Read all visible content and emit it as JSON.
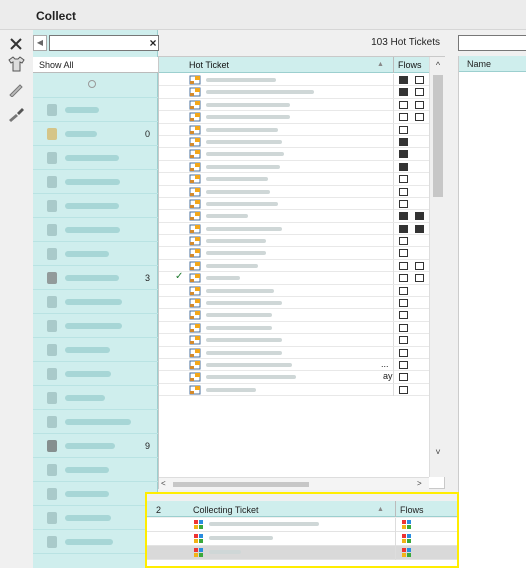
{
  "window": {
    "title": "Collect"
  },
  "toolbar": {
    "icons": [
      "close-icon",
      "shirt-icon",
      "marker-icon",
      "brush-icon"
    ]
  },
  "search": {
    "placeholder": "",
    "count_label": "103 Hot Tickets",
    "right_placeholder": ""
  },
  "left": {
    "show_all": "Show All",
    "counts": [
      "0",
      "3",
      "9",
      "2"
    ]
  },
  "table": {
    "headers": {
      "ticket": "Hot Ticket",
      "flows": "Flows"
    },
    "rows": [
      {
        "flows": [
          "ticket",
          "doc"
        ]
      },
      {
        "flows": [
          "ticket",
          "doc"
        ]
      },
      {
        "flows": [
          "box",
          "doc"
        ]
      },
      {
        "flows": [
          "box",
          "doc"
        ]
      },
      {
        "flows": [
          "doc"
        ]
      },
      {
        "flows": [
          "ticket"
        ]
      },
      {
        "flows": [
          "ticket"
        ]
      },
      {
        "flows": [
          "ticket"
        ]
      },
      {
        "flows": [
          "disk"
        ]
      },
      {
        "flows": [
          "disk"
        ]
      },
      {
        "flows": [
          "doc"
        ]
      },
      {
        "flows": [
          "ticket",
          "ticket"
        ]
      },
      {
        "flows": [
          "ticket",
          "ticket"
        ]
      },
      {
        "flows": [
          "disk"
        ]
      },
      {
        "flows": [
          "disk"
        ]
      },
      {
        "flows": [
          "box",
          "doc"
        ]
      },
      {
        "flows": [
          "box",
          "doc"
        ],
        "checked": true
      },
      {
        "flows": [
          "doc"
        ]
      },
      {
        "flows": [
          "doc"
        ]
      },
      {
        "flows": [
          "doc"
        ]
      },
      {
        "flows": [
          "doc"
        ]
      },
      {
        "flows": [
          "doc"
        ]
      },
      {
        "flows": [
          "doc"
        ]
      },
      {
        "flows": [
          "doc"
        ],
        "truncated": true
      },
      {
        "flows": [
          "doc"
        ],
        "tail": "ay"
      },
      {
        "flows": [
          "doc"
        ]
      }
    ],
    "truncated_text": "...",
    "tail_text": "ay"
  },
  "right": {
    "header": "Name"
  },
  "collecting": {
    "count": "2",
    "headers": {
      "ticket": "Collecting Ticket",
      "flows": "Flows"
    },
    "rows": [
      {},
      {},
      {
        "selected": true
      }
    ]
  }
}
